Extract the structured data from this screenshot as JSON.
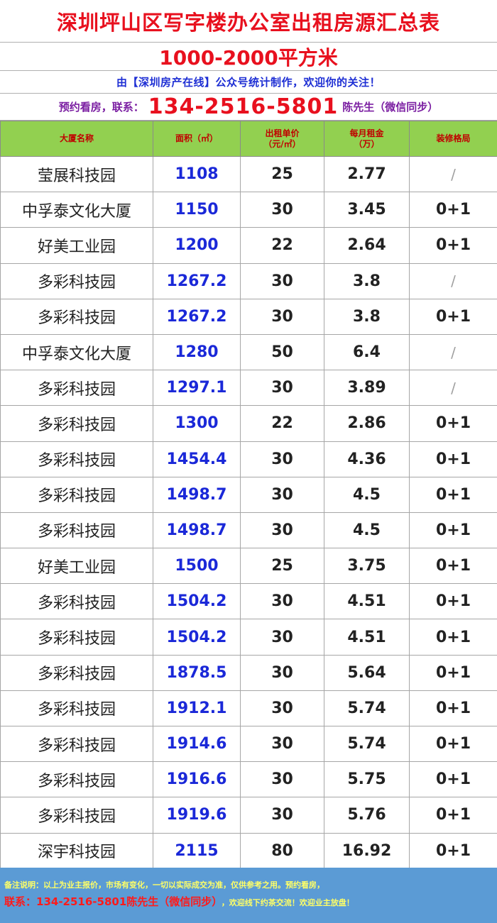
{
  "header": {
    "title": "深圳坪山区写字楼办公室出租房源汇总表",
    "subtitle": "1000-2000平方米",
    "credit": "由【深圳房产在线】公众号统计制作，欢迎你的关注！",
    "contact_prefix": "预约看房，联系：",
    "contact_phone": "134-2516-5801",
    "contact_suffix": "陈先生（微信同步）"
  },
  "table": {
    "columns": [
      {
        "main": "大厦名称",
        "sub": ""
      },
      {
        "main": "面积（㎡）",
        "sub": ""
      },
      {
        "main": "出租单价",
        "sub": "（元/㎡）"
      },
      {
        "main": "每月租金",
        "sub": "（万）"
      },
      {
        "main": "装修格局",
        "sub": ""
      }
    ],
    "rows": [
      {
        "name": "莹展科技园",
        "area": "1108",
        "price": "25",
        "rent": "2.77",
        "layout": "/"
      },
      {
        "name": "中孚泰文化大厦",
        "area": "1150",
        "price": "30",
        "rent": "3.45",
        "layout": "0+1"
      },
      {
        "name": "好美工业园",
        "area": "1200",
        "price": "22",
        "rent": "2.64",
        "layout": "0+1"
      },
      {
        "name": "多彩科技园",
        "area": "1267.2",
        "price": "30",
        "rent": "3.8",
        "layout": "/"
      },
      {
        "name": "多彩科技园",
        "area": "1267.2",
        "price": "30",
        "rent": "3.8",
        "layout": "0+1"
      },
      {
        "name": "中孚泰文化大厦",
        "area": "1280",
        "price": "50",
        "rent": "6.4",
        "layout": "/"
      },
      {
        "name": "多彩科技园",
        "area": "1297.1",
        "price": "30",
        "rent": "3.89",
        "layout": "/"
      },
      {
        "name": "多彩科技园",
        "area": "1300",
        "price": "22",
        "rent": "2.86",
        "layout": "0+1"
      },
      {
        "name": "多彩科技园",
        "area": "1454.4",
        "price": "30",
        "rent": "4.36",
        "layout": "0+1"
      },
      {
        "name": "多彩科技园",
        "area": "1498.7",
        "price": "30",
        "rent": "4.5",
        "layout": "0+1"
      },
      {
        "name": "多彩科技园",
        "area": "1498.7",
        "price": "30",
        "rent": "4.5",
        "layout": "0+1"
      },
      {
        "name": "好美工业园",
        "area": "1500",
        "price": "25",
        "rent": "3.75",
        "layout": "0+1"
      },
      {
        "name": "多彩科技园",
        "area": "1504.2",
        "price": "30",
        "rent": "4.51",
        "layout": "0+1"
      },
      {
        "name": "多彩科技园",
        "area": "1504.2",
        "price": "30",
        "rent": "4.51",
        "layout": "0+1"
      },
      {
        "name": "多彩科技园",
        "area": "1878.5",
        "price": "30",
        "rent": "5.64",
        "layout": "0+1"
      },
      {
        "name": "多彩科技园",
        "area": "1912.1",
        "price": "30",
        "rent": "5.74",
        "layout": "0+1"
      },
      {
        "name": "多彩科技园",
        "area": "1914.6",
        "price": "30",
        "rent": "5.74",
        "layout": "0+1"
      },
      {
        "name": "多彩科技园",
        "area": "1916.6",
        "price": "30",
        "rent": "5.75",
        "layout": "0+1"
      },
      {
        "name": "多彩科技园",
        "area": "1919.6",
        "price": "30",
        "rent": "5.76",
        "layout": "0+1"
      },
      {
        "name": "深宇科技园",
        "area": "2115",
        "price": "80",
        "rent": "16.92",
        "layout": "0+1"
      }
    ]
  },
  "footer": {
    "note": "备注说明：以上为业主报价，市场有变化，一切以实际成交为准，仅供参考之用。预约看房，",
    "contact_label": "联系：",
    "contact_phone": "134-2516-5801陈先生（微信同步）",
    "tail": "，欢迎线下约茶交流！欢迎业主放盘！"
  },
  "colors": {
    "title_red": "#e8101e",
    "credit_blue": "#1e2fd4",
    "contact_purple": "#7b1fa2",
    "header_green": "#92d050",
    "area_blue": "#1a28d8",
    "footer_blue": "#5b9bd5",
    "footer_yellow": "#ffff66"
  }
}
